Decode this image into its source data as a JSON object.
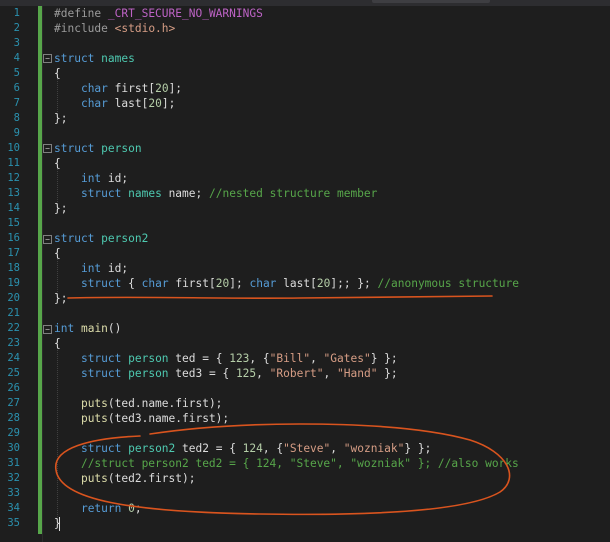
{
  "editor": {
    "line_numbers": [
      "1",
      "2",
      "3",
      "4",
      "5",
      "6",
      "7",
      "8",
      "9",
      "10",
      "11",
      "12",
      "13",
      "14",
      "15",
      "16",
      "17",
      "18",
      "19",
      "20",
      "21",
      "22",
      "23",
      "24",
      "25",
      "26",
      "27",
      "28",
      "29",
      "30",
      "31",
      "32",
      "33",
      "34",
      "35"
    ],
    "lines": {
      "l1_pp": "#define",
      "l1_macro": "_CRT_SECURE_NO_WARNINGS",
      "l2_pp": "#include",
      "l2_header": "<stdio.h>",
      "kw_struct": "struct",
      "kw_char": "char",
      "kw_int": "int",
      "names": "names",
      "first_decl": "first[",
      "last_decl": "last[",
      "num_20": "20",
      "decl_end": "];",
      "open_brace": "{",
      "close_brace_semi": "};",
      "close_brace": "}",
      "person": "person",
      "person2": "person2",
      "id_decl": "id;",
      "name_decl": "name;",
      "comment_nested": "//nested structure member",
      "l19_anon_tail": "; };",
      "comment_anon": "//anonymous structure",
      "main": "main",
      "parens": "()",
      "ted": "ted",
      "ted3": "ted3",
      "ted2": "ted2",
      "eq_open": " = { ",
      "num_123": "123",
      "num_125": "125",
      "num_124": "124",
      "comma_space": ", ",
      "comma_brace": ", {",
      "str_bill": "\"Bill\"",
      "str_gates": "\"Gates\"",
      "str_robert": "\"Robert\"",
      "str_hand": "\"Hand\"",
      "str_steve": "\"Steve\"",
      "str_wozniak": "\"wozniak\"",
      "end_nested": "} };",
      "end_flat": " };",
      "puts": "puts",
      "arg_ted_first": "(ted.name.first);",
      "arg_ted3_first": "(ted3.name.first);",
      "arg_ted2_first": "(ted2.first);",
      "l31_comment": "//struct person2 ted2 = { 124, \"Steve\", \"wozniak\" }; //also works",
      "kw_return": "return",
      "num_0": "0",
      "semi": ";"
    }
  },
  "colors": {
    "background": "#1e1e1e",
    "line_number": "#2b91af",
    "keyword": "#569cd6",
    "type": "#4ec9b0",
    "function": "#dcdcaa",
    "string": "#d69d85",
    "comment": "#57a64a",
    "macro": "#bd63c5",
    "number": "#b5cea8",
    "change_bar": "#57a64a",
    "annotation_ink": "#d9541e"
  },
  "icons": {
    "fold_marker": "collapse-minus-icon",
    "annotation_underline": "hand-drawn-underline",
    "annotation_circle": "hand-drawn-circle"
  }
}
